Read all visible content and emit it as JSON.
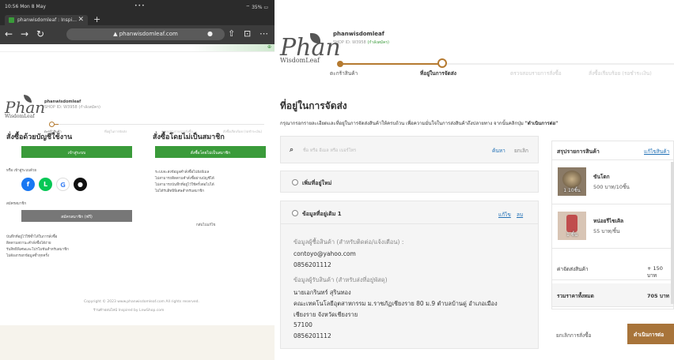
{
  "left": {
    "status": {
      "time": "10:56  Mon 8 May",
      "dots": "•••",
      "battery": "⌔ 35% ▭"
    },
    "tab": {
      "title": "phanwisdomleaf : Inspi...",
      "close": "✕",
      "new": "+"
    },
    "address": {
      "url": "▲ phanwisdomleaf.com"
    },
    "logo": {
      "main": "Phan",
      "sub": "WisdomLeaf"
    },
    "shop": {
      "name": "phanwisdomleaf",
      "id": "SHOP ID: W3958 (กำลังสมัคร)"
    },
    "steps": [
      "ตะกร้าสินค้า",
      "ที่อยู่ในการจัดส่ง",
      "ตรวจสอบรายการสั่งซื้อ",
      "สั่งซื้อเรียบร้อย (รอชำระเงิน)"
    ],
    "member": {
      "title": "สั่งซื้อด้วยบัญชีใช้งาน",
      "login_button": "เข้าสู่ระบบ",
      "or_social": "หรือ เข้าสู่ระบบด้วย",
      "register_label": "สมัครสมาชิก",
      "register_button": "สมัครสมาชิก (ฟรี)",
      "benefits": [
        "บันทึกที่อยู่ไว้ใช้ซ้ำได้ในการสั่งซื้อ",
        "ติดตามสถานะคำสั่งซื้อได้ง่าย",
        "รับสิทธิพิเศษและโปรโมชันสำหรับสมาชิก",
        "ไม่ต้องกรอกข้อมูลซ้ำทุกครั้ง"
      ]
    },
    "guest": {
      "title": "สั่งซื้อโดยไม่เป็นสมาชิก",
      "button": "สั่งซื้อโดยไม่เป็นสมาชิก",
      "notes": [
        "ระบบจะส่งข้อมูลคำสั่งซื้อไปยังอีเมล",
        "ไม่สามารถติดตามคำสั่งซื้อผ่านบัญชีได้",
        "ไม่สามารถบันทึกที่อยู่ไว้ใช้ครั้งต่อไปได้",
        "ไม่ได้รับสิทธิพิเศษสำหรับสมาชิก"
      ],
      "back_link": "กลับไปแก้ไข"
    },
    "footer": {
      "copyright": "Copyright © 2023 www.phanwisdomleaf.com All rights reserved.",
      "links": "ร้านค้าออนไลน์   Inspired by LnwShop.com"
    }
  },
  "right": {
    "logo": {
      "main": "Phan",
      "sub": "WisdomLeaf"
    },
    "shop": {
      "name": "phanwisdomleaf",
      "id_prefix": "SHOP ID: W3958",
      "id_status": "(กำลังสมัคร)"
    },
    "steps": [
      "ตะกร้าสินค้า",
      "ที่อยู่ในการจัดส่ง",
      "ตรวจสอบรายการสั่งซื้อ",
      "สั่งซื้อเรียบร้อย (รอชำระเงิน)"
    ],
    "title": "ที่อยู่ในการจัดส่ง",
    "description": "กรุณากรอกรายละเอียดและที่อยู่ในการจัดส่งสินค้าให้ครบถ้วน เพื่อความมั่นใจในการส่งสินค้าถึงปลายทาง จากนั้นคลิกปุ่ม",
    "description_action": "\"ดำเนินการต่อ\"",
    "search": {
      "placeholder": "ชื่อ หรือ อีเมล หรือ เบอร์โทร",
      "search_label": "ค้นหา",
      "clear_label": "ยกเลิก"
    },
    "new_address": "เพิ่มที่อยู่ใหม่",
    "old_address": {
      "label": "ข้อมูลที่อยู่เดิม 1",
      "edit": "แก้ไข",
      "delete": "ลบ",
      "contact_label": "ข้อมูลผู้ซื้อสินค้า (สำหรับติดต่อ/แจ้งเตือน) :",
      "email": "contoyo@yahoo.com",
      "phone": "0856201112",
      "shipping_label": "ข้อมูลผู้รับสินค้า (สำหรับส่งที่อยู่พัสดุ)",
      "name": "นายเอกรินทร์ สุรินทอง",
      "line1": "คณะเทคโนโลยีอุตสาหกรรม ม.ราชภัฏเชียงราย 80 ม.9 ตำบลบ้านดู่ อำเภอเมือง",
      "line2": "เชียงราย จังหวัดเชียงราย",
      "zip": "57100",
      "phone2": "0856201112"
    },
    "summary": {
      "title": "สรุปรายการสินค้า",
      "edit": "แก้ไขสินค้า",
      "items": [
        {
          "name": "ขันโตก",
          "price": "500 บาท/10ชิ้น",
          "qty": "1 10ชิ้น"
        },
        {
          "name": "หน่อยรีไซเคิล",
          "price": "55 บาท/ชิ้น",
          "qty": "1 ชิ้น"
        }
      ],
      "shipping_label": "ค่าจัดส่งสินค้า",
      "shipping_value": "+ 150 บาท",
      "total_label": "รวมราคาทั้งหมด",
      "total_value": "705 บาท"
    },
    "cancel": "ยกเลิกการสั่งซื้อ",
    "proceed": "ดำเนินการต่อ"
  }
}
